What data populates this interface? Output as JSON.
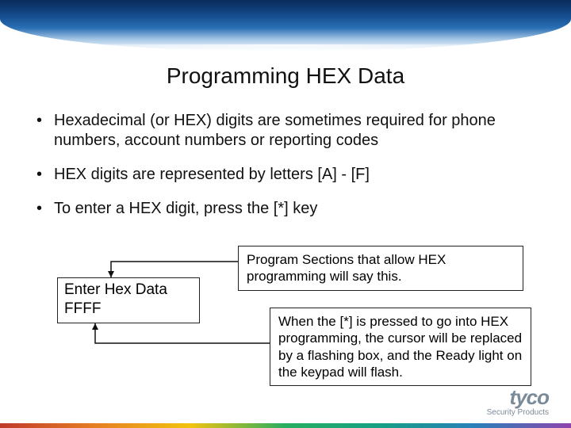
{
  "title": "Programming HEX Data",
  "bullets": [
    "Hexadecimal (or HEX) digits are sometimes required for phone numbers, account numbers or reporting codes",
    "HEX digits are represented by letters [A] - [F]",
    "To enter a HEX digit, press the [*] key"
  ],
  "display": {
    "line1": "Enter Hex Data",
    "line2": "FFFF"
  },
  "callouts": {
    "top": "Program Sections that allow HEX programming will say this.",
    "bottom": "When the [*] is pressed to go into HEX programming, the cursor will be replaced by a flashing box, and the Ready light on the keypad will flash."
  },
  "logo": {
    "main": "tyco",
    "sub": "Security Products"
  }
}
